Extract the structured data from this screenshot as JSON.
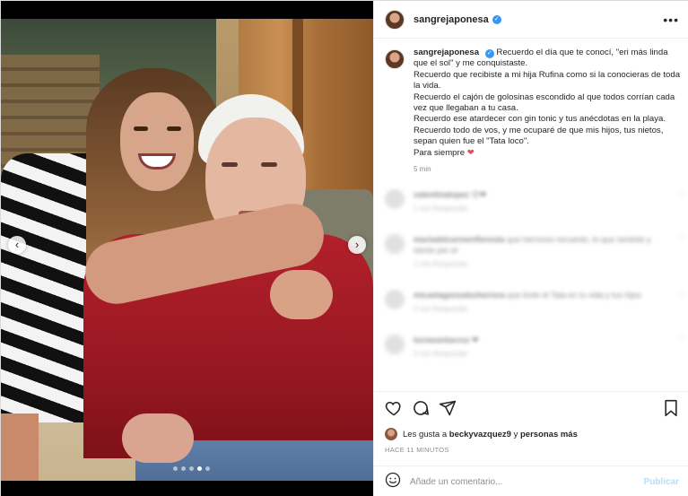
{
  "post": {
    "username": "sangrejaponesa",
    "verified_mark": "✓",
    "more_label": "•••",
    "caption_lines": [
      "Recuerdo el día que te conocí, \"eri más linda que el sol\" y me conquistaste.",
      "Recuerdo que recibiste a mi hija Rufina como si la conocieras de toda la vida.",
      "Recuerdo el cajón de golosinas escondido al que todos corrían cada vez que llegaban a tu casa.",
      "Recuerdo ese atardecer con gin tonic y tus anécdotas en la playa.",
      "Recuerdo todo de vos, y me ocuparé de que mis hijos, tus nietos, sepan quien fue el \"Tata loco\".",
      "Para siempre"
    ],
    "caption_emoji": "❤",
    "time_ago": "5 min"
  },
  "carousel": {
    "prev_label": "‹",
    "next_label": "›",
    "dot_count": 5,
    "active_dot": 3
  },
  "comments": [
    {
      "username": "valentinalopez",
      "text": "😍❤",
      "meta": "1 min   Responder"
    },
    {
      "username": "mariadelcarmenfloresta",
      "text": "que hermoso recuerdo, lo que sentiste y siento por el",
      "meta": "1 min   Responder"
    },
    {
      "username": "micaelagonzalezherrera",
      "text": "que lindo el Tata en tu vida y tus hijos",
      "meta": "2 min   Responder"
    },
    {
      "username": "luciasantacruz",
      "text": "❤",
      "meta": "3 min   Responder"
    }
  ],
  "actions": {
    "likes_prefix": "Les gusta a",
    "likes_user": "beckyvazquez9",
    "likes_joiner": "y",
    "likes_others": "personas más",
    "posted_ago": "HACE 11 MINUTOS"
  },
  "add_comment": {
    "placeholder": "Añade un comentario...",
    "publish_label": "Publicar"
  },
  "colors": {
    "accent_blue": "#3897f0",
    "heart_red": "#ed4956",
    "muted": "#8e8e8e",
    "publish_disabled": "#b2dffc"
  }
}
